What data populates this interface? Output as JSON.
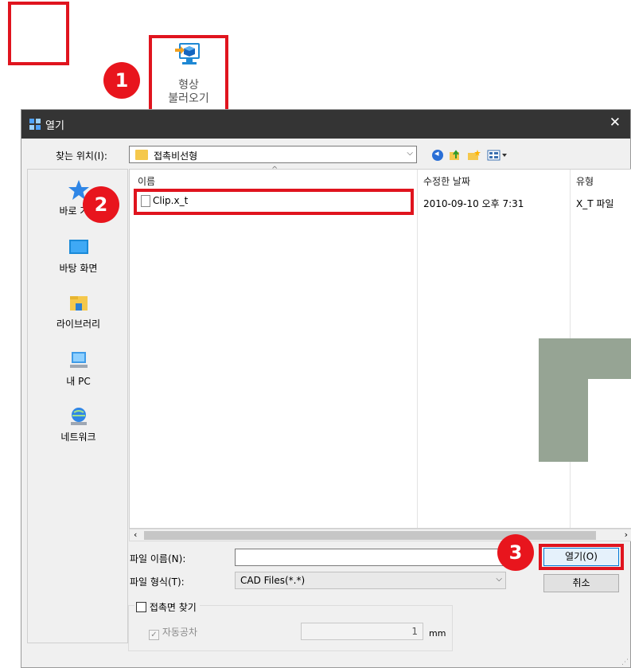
{
  "toolbar": {
    "load_shape_line1": "형상",
    "load_shape_line2": "불러오기"
  },
  "badges": [
    "1",
    "2",
    "3"
  ],
  "dialog": {
    "title": "열기",
    "close_glyph": "✕",
    "look_in_label": "찾는 위치(I):",
    "look_in_value": "접촉비선형",
    "columns": [
      "이름",
      "수정한 날짜",
      "유형"
    ],
    "files": [
      {
        "name": "Clip.x_t",
        "modified": "2010-09-10 오후 7:31",
        "type": "X_T 파일"
      }
    ],
    "sidebar": [
      {
        "label": "바로 가기",
        "icon": "star-icon"
      },
      {
        "label": "바탕 화면",
        "icon": "desktop-icon"
      },
      {
        "label": "라이브러리",
        "icon": "library-icon"
      },
      {
        "label": "내 PC",
        "icon": "computer-icon"
      },
      {
        "label": "네트워크",
        "icon": "network-icon"
      }
    ],
    "filename_label": "파일 이름(N):",
    "filename_value": "",
    "filetype_label": "파일 형식(T):",
    "filetype_value": "CAD Files(*.*)",
    "open_button": "열기(O)",
    "cancel_button": "취소",
    "contact_face_label": "접촉면 찾기",
    "contact_face_checked": false,
    "auto_tol_label": "자동공차",
    "auto_tol_checked": true,
    "tolerance_value": "1",
    "tolerance_unit": "mm"
  },
  "colors": {
    "highlight_red": "#e0141e",
    "title_bar": "#343434",
    "panel_gray": "#f0f0f0",
    "overlay_green": "#96a494"
  }
}
